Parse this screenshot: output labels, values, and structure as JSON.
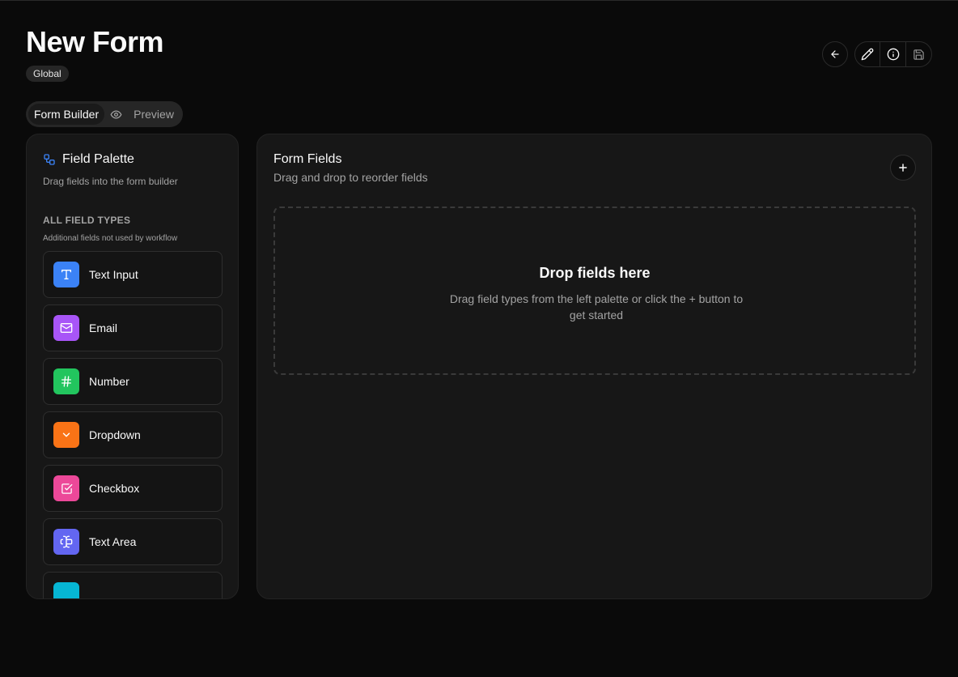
{
  "header": {
    "title": "New Form",
    "badge": "Global"
  },
  "actions": {
    "back": "arrow-left-icon",
    "edit": "pencil-icon",
    "info": "info-icon",
    "save": "save-icon"
  },
  "tabs": [
    {
      "label": "Form Builder",
      "active": true
    },
    {
      "label": "Preview",
      "active": false,
      "icon": "eye-icon"
    }
  ],
  "palette": {
    "title": "Field Palette",
    "subtitle": "Drag fields into the form builder",
    "section_title": "ALL FIELD TYPES",
    "section_subtitle": "Additional fields not used by workflow",
    "items": [
      {
        "label": "Text Input",
        "icon": "text-icon",
        "color": "#3b82f6"
      },
      {
        "label": "Email",
        "icon": "mail-icon",
        "color": "#a855f7"
      },
      {
        "label": "Number",
        "icon": "hash-icon",
        "color": "#22c55e"
      },
      {
        "label": "Dropdown",
        "icon": "chevron-down-icon",
        "color": "#f97316"
      },
      {
        "label": "Checkbox",
        "icon": "checkbox-icon",
        "color": "#ec4899"
      },
      {
        "label": "Text Area",
        "icon": "textarea-icon",
        "color": "#6366f1"
      },
      {
        "label": "",
        "icon": "field-icon",
        "color": "#06b6d4"
      }
    ]
  },
  "form": {
    "title": "Form Fields",
    "subtitle": "Drag and drop to reorder fields",
    "drop_title": "Drop fields here",
    "drop_subtitle": "Drag field types from the left palette or click the + button to get started"
  },
  "colors": {
    "background": "#0a0a0a",
    "panel": "#171717",
    "accent_blue": "#3b82f6"
  }
}
